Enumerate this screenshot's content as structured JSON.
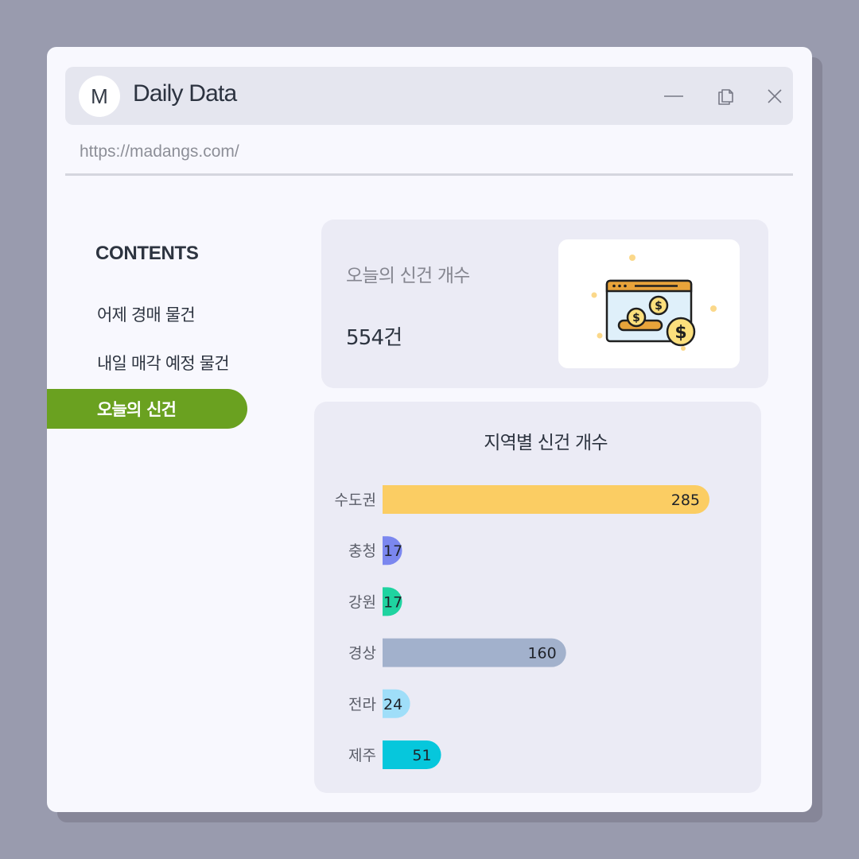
{
  "app": {
    "logo_letter": "M",
    "title": "Daily Data",
    "url": "https://madangs.com/"
  },
  "window_controls": {
    "minimize_icon": "minimize-icon",
    "restore_icon": "restore-icon",
    "close_icon": "close-icon"
  },
  "sidebar": {
    "title": "CONTENTS",
    "items": [
      {
        "label": "어제 경매 물건",
        "active": false
      },
      {
        "label": "내일 매각 예정 물건",
        "active": false
      },
      {
        "label": "오늘의 신건",
        "active": true
      }
    ],
    "active_color": "#6aa120"
  },
  "summary": {
    "label": "오늘의 신건 개수",
    "value": "554건",
    "illustration_icon": "money-browser-icon"
  },
  "chart_data": {
    "type": "bar",
    "orientation": "horizontal",
    "title": "지역별 신건 개수",
    "categories": [
      "수도권",
      "충청",
      "강원",
      "경상",
      "전라",
      "제주"
    ],
    "values": [
      285,
      17,
      17,
      160,
      24,
      51
    ],
    "colors": [
      "#fbcd63",
      "#7b87ef",
      "#1fd3a0",
      "#a2b1cc",
      "#9fdef9",
      "#06c7dc"
    ],
    "xlim": [
      0,
      285
    ],
    "grid": false,
    "data_labels": true
  }
}
